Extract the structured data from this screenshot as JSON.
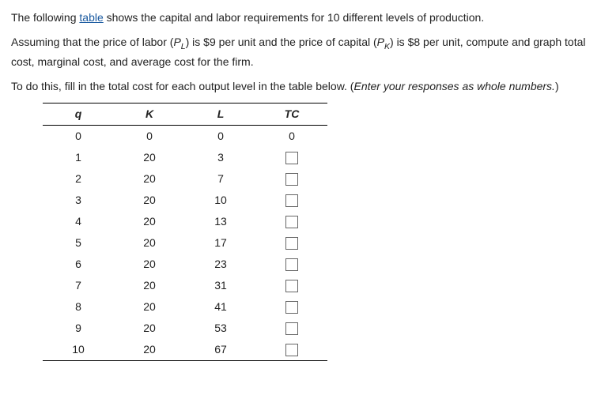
{
  "paragraphs": {
    "p1_pre": "The following ",
    "p1_link": "table",
    "p1_post": " shows the capital and labor requirements for 10 different levels of production.",
    "p2_a": "Assuming that the price of labor (",
    "p2_pvar": "P",
    "p2_lsub": "L",
    "p2_b": ") is $9 per unit and the price of capital (",
    "p2_ksub": "K",
    "p2_c": ") is $8 per unit, compute and graph total cost, marginal cost, and average cost for the firm.",
    "p3_a": "To do this, fill in the total cost for each output level in the table below. (",
    "p3_i": "Enter your responses as whole numbers.",
    "p3_b": ")"
  },
  "table": {
    "headers": {
      "q": "q",
      "k": "K",
      "l": "L",
      "tc": "TC"
    },
    "rows": [
      {
        "q": "0",
        "k": "0",
        "l": "0",
        "tc": "0",
        "input": false
      },
      {
        "q": "1",
        "k": "20",
        "l": "3",
        "tc": "",
        "input": true
      },
      {
        "q": "2",
        "k": "20",
        "l": "7",
        "tc": "",
        "input": true
      },
      {
        "q": "3",
        "k": "20",
        "l": "10",
        "tc": "",
        "input": true
      },
      {
        "q": "4",
        "k": "20",
        "l": "13",
        "tc": "",
        "input": true
      },
      {
        "q": "5",
        "k": "20",
        "l": "17",
        "tc": "",
        "input": true
      },
      {
        "q": "6",
        "k": "20",
        "l": "23",
        "tc": "",
        "input": true
      },
      {
        "q": "7",
        "k": "20",
        "l": "31",
        "tc": "",
        "input": true
      },
      {
        "q": "8",
        "k": "20",
        "l": "41",
        "tc": "",
        "input": true
      },
      {
        "q": "9",
        "k": "20",
        "l": "53",
        "tc": "",
        "input": true
      },
      {
        "q": "10",
        "k": "20",
        "l": "67",
        "tc": "",
        "input": true
      }
    ]
  }
}
